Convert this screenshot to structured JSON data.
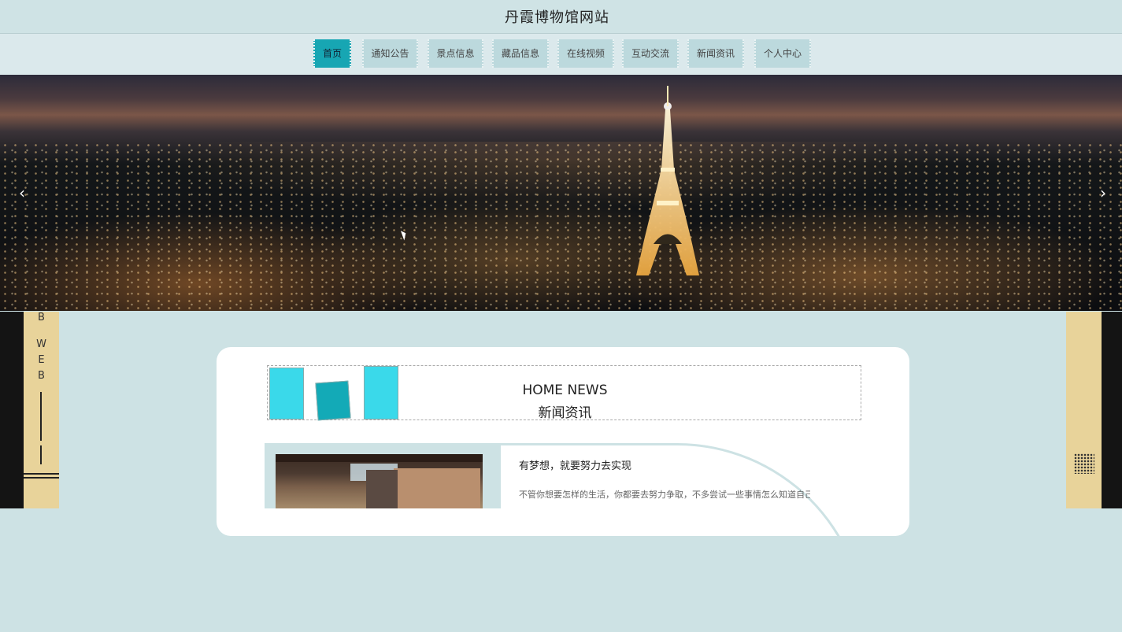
{
  "header": {
    "site_title": "丹霞博物馆网站"
  },
  "nav": {
    "items": [
      {
        "label": "首页",
        "active": true
      },
      {
        "label": "通知公告",
        "active": false
      },
      {
        "label": "景点信息",
        "active": false
      },
      {
        "label": "藏品信息",
        "active": false
      },
      {
        "label": "在线视频",
        "active": false
      },
      {
        "label": "互动交流",
        "active": false
      },
      {
        "label": "新闻资讯",
        "active": false
      },
      {
        "label": "个人中心",
        "active": false
      }
    ]
  },
  "banner": {
    "prev_icon": "chevron-left-icon",
    "next_icon": "chevron-right-icon",
    "prev_glyph": "‹",
    "next_glyph": "›"
  },
  "side_left": {
    "letters": [
      "B",
      "W",
      "E",
      "B"
    ]
  },
  "side_right": {
    "icon": "grid-pattern-icon"
  },
  "news_section": {
    "title_en": "HOME NEWS",
    "title_zh": "新闻资讯",
    "item": {
      "title": "有梦想，就要努力去实现",
      "excerpt": "不管你想要怎样的生活，你都要去努力争取，不多尝试一些事情怎么知道自己"
    }
  },
  "colors": {
    "accent": "#17a6b3",
    "nav_item_bg": "#bcd9dd",
    "page_bg": "#cde2e4",
    "side_tan": "#e8d39a",
    "deco_cyan": "#3ad9ea"
  }
}
